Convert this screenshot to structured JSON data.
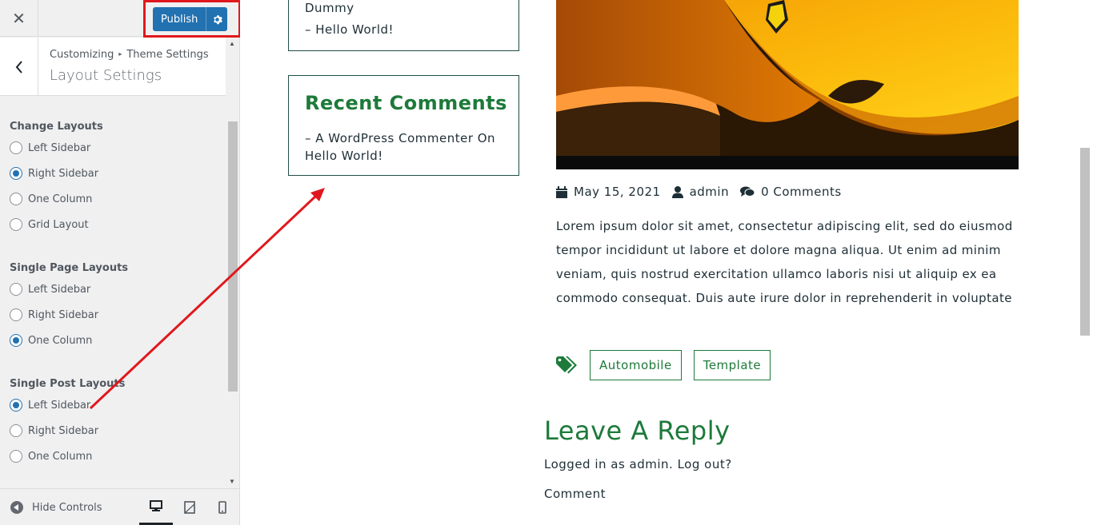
{
  "customizer": {
    "close_icon": "close-icon",
    "publish_label": "Publish",
    "breadcrumb_root": "Customizing",
    "breadcrumb_parent": "Theme Settings",
    "section_title": "Layout Settings",
    "groups": [
      {
        "title": "Change Layouts",
        "options": [
          "Left Sidebar",
          "Right Sidebar",
          "One Column",
          "Grid Layout"
        ],
        "selected": "Right Sidebar"
      },
      {
        "title": "Single Page Layouts",
        "options": [
          "Left Sidebar",
          "Right Sidebar",
          "One Column"
        ],
        "selected": "One Column"
      },
      {
        "title": "Single Post Layouts",
        "options": [
          "Left Sidebar",
          "Right Sidebar",
          "One Column"
        ],
        "selected": "Left Sidebar"
      }
    ],
    "footer": {
      "hide_controls": "Hide Controls"
    },
    "accent": "#2271b1"
  },
  "preview": {
    "prev_widget": {
      "line1": "Dummy",
      "line2": "–   Hello World!"
    },
    "recent_comments": {
      "title": "Recent Comments",
      "item": "–  A WordPress Commenter On Hello World!"
    },
    "post": {
      "date": "May 15, 2021",
      "author": "admin",
      "comments": "0 Comments",
      "excerpt": "Lorem ipsum dolor sit amet, consectetur adipiscing elit, sed do eiusmod tempor incididunt ut labore et dolore magna aliqua. Ut enim ad minim veniam, quis nostrud exercitation ullamco laboris nisi ut aliquip ex ea commodo consequat. Duis aute irure dolor in reprehenderit in voluptate",
      "tags": [
        "Automobile",
        "Template"
      ]
    },
    "reply": {
      "title": "Leave A Reply",
      "logged_in": "Logged in as admin. Log out?",
      "comment_label": "Comment"
    },
    "theme_green": "#1d7a3a"
  },
  "annotation": {
    "highlight_color": "#e0181d"
  }
}
